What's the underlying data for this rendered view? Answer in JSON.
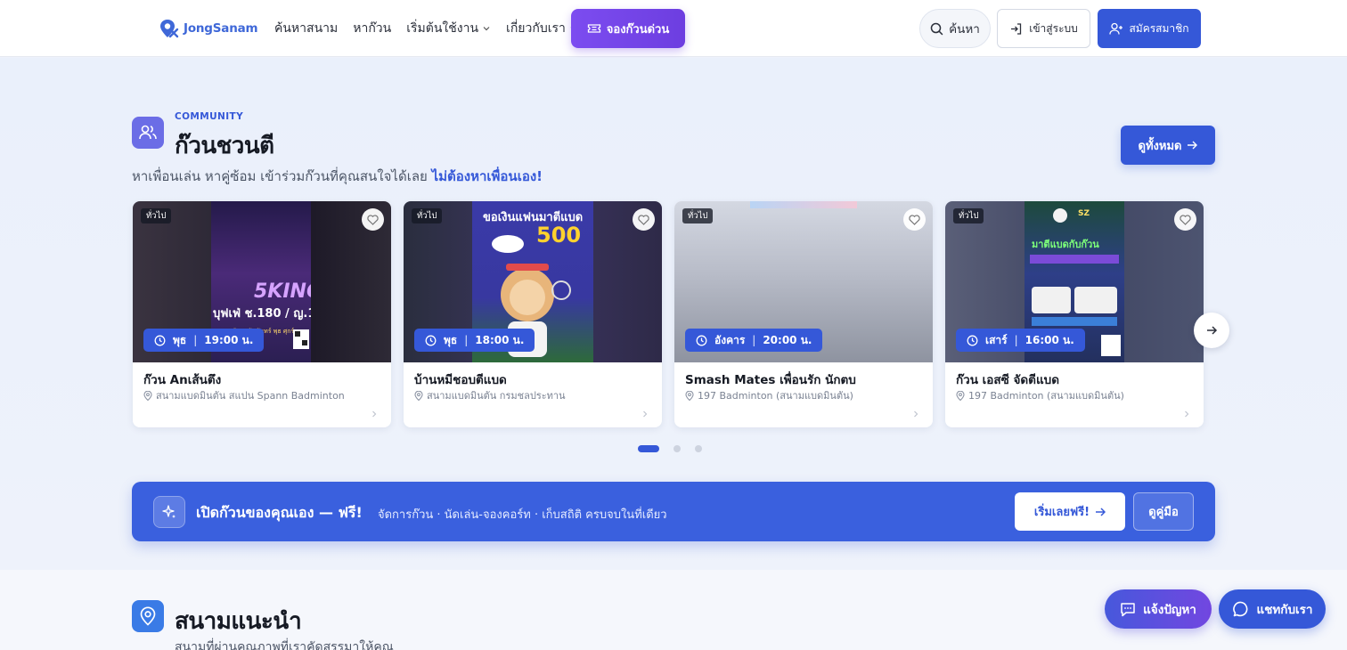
{
  "brand": {
    "name": "JongSanam",
    "color": "#3f68d8"
  },
  "nav": {
    "menu": [
      {
        "label": "ค้นหาสนาม",
        "dropdown": false
      },
      {
        "label": "หาก๊วน",
        "dropdown": false
      },
      {
        "label": "เริ่มต้นใช้งาน",
        "dropdown": true
      },
      {
        "label": "เกี่ยวกับเรา",
        "dropdown": true
      }
    ],
    "quick_book": {
      "label": "จองก๊วนด่วน",
      "icon": "ticket-icon",
      "color": "#7c4cf0"
    },
    "search": {
      "label": "ค้นหา",
      "icon": "search-icon"
    },
    "login": {
      "label": "เข้าสู่ระบบ",
      "icon": "login-icon"
    },
    "signup": {
      "label": "สมัครสมาชิก",
      "icon": "user-plus-icon",
      "color": "#3558d8"
    }
  },
  "community": {
    "eyebrow": "COMMUNITY",
    "title": "ก๊วนชวนตี",
    "subtitle": "หาเพื่อนเล่น หาคู่ซ้อม เข้าร่วมก๊วนที่คุณสนใจได้เลย",
    "subtitle_highlight": "ไม่ต้องหาเพื่อนเอง!",
    "view_all": "ดูทั้งหมด",
    "cards": [
      {
        "tag": "ทั่วไป",
        "day": "พุธ",
        "time": "19:00 น.",
        "title": "ก๊วน Anเส้นตึง",
        "venue": "สนามแบดมินตัน สแปน Spann Badminton"
      },
      {
        "tag": "ทั่วไป",
        "day": "พุธ",
        "time": "18:00 น.",
        "title": "บ้านหมีชอบตีแบด",
        "venue": "สนามแบดมินตัน กรมชลประทาน"
      },
      {
        "tag": "ทั่วไป",
        "day": "อังคาร",
        "time": "20:00 น.",
        "title": "Smash Mates เพื่อนรัก นักตบ",
        "venue": "197 Badminton (สนามแบดมินตัน)"
      },
      {
        "tag": "ทั่วไป",
        "day": "เสาร์",
        "time": "16:00 น.",
        "title": "ก๊วน เอสซี จัดตีแบด",
        "venue": "197 Badminton (สนามแบดมินตัน)"
      }
    ],
    "pagination": {
      "pages": 3,
      "active": 1
    }
  },
  "banner": {
    "title": "เปิดก๊วนของคุณเอง — ฟรี!",
    "desc": "จัดการก๊วน · นัดเล่น-จองคอร์ท · เก็บสถิติ ครบจบในที่เดียว",
    "start": "เริ่มเลยฟรี!",
    "guide": "ดูคู่มือ"
  },
  "venues": {
    "title": "สนามแนะนำ",
    "subtitle": "สนามที่ผ่านคุณภาพที่เราคัดสรรมาให้คุณ"
  },
  "floating": {
    "report": "แจ้งปัญหา",
    "chat": "แชทกับเรา"
  }
}
